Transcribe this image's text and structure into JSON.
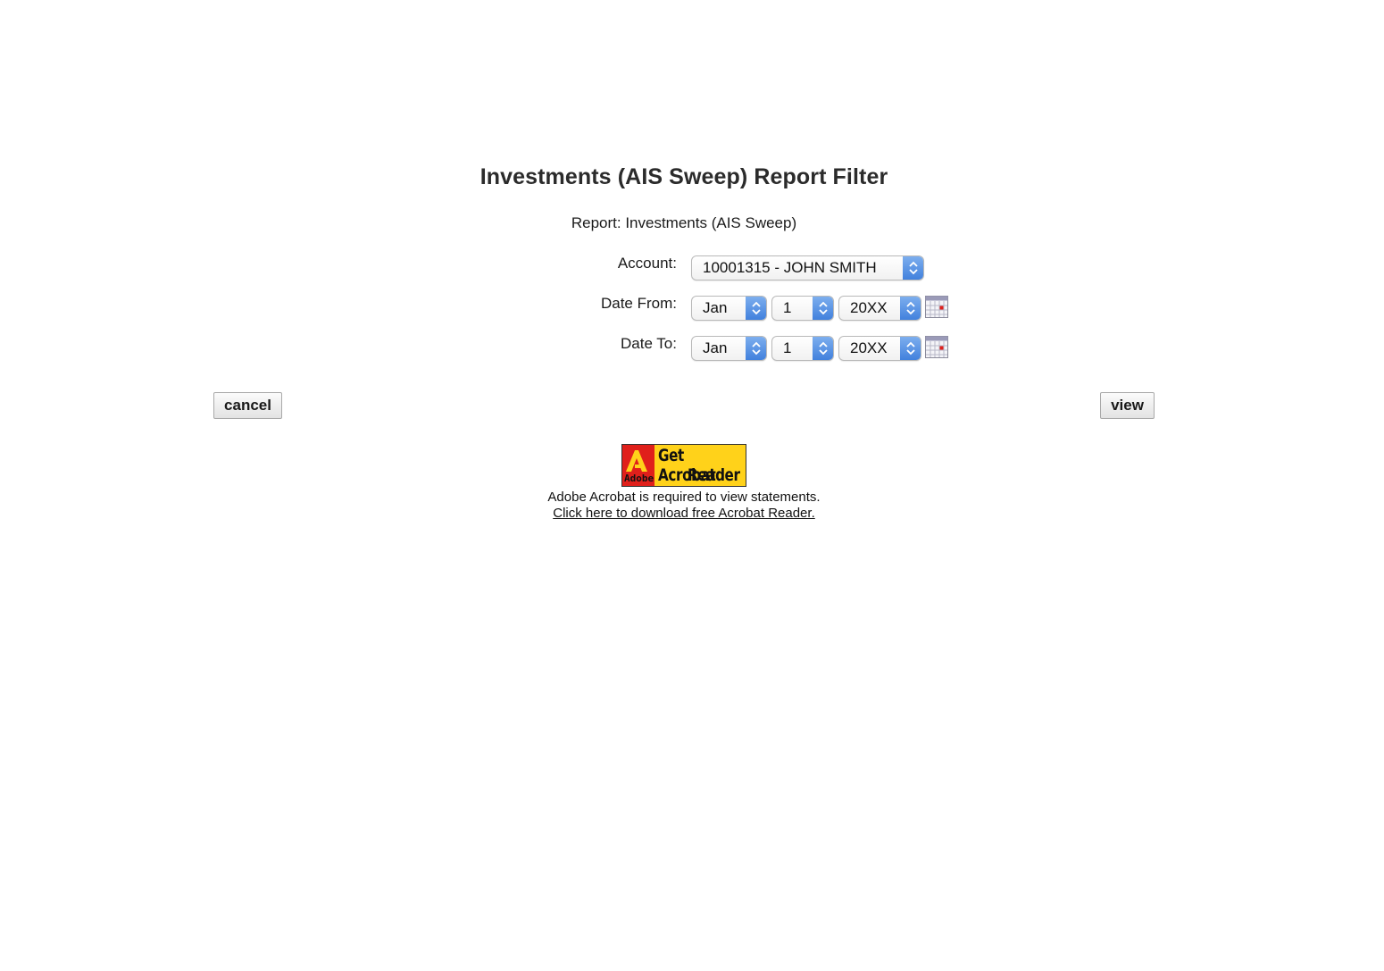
{
  "page": {
    "title": "Investments (AIS Sweep) Report Filter",
    "report_line": "Report: Investments (AIS Sweep)"
  },
  "form": {
    "account": {
      "label": "Account:",
      "value": "10001315 - JOHN SMITH"
    },
    "date_from": {
      "label": "Date From:",
      "month": "Jan",
      "day": "1",
      "year": "20XX"
    },
    "date_to": {
      "label": "Date To:",
      "month": "Jan",
      "day": "1",
      "year": "20XX"
    }
  },
  "buttons": {
    "cancel": "cancel",
    "view": "view"
  },
  "acrobat": {
    "badge_brand": "Adobe",
    "badge_line1": "Get Acrobat",
    "badge_line2": "Reader",
    "note": "Adobe Acrobat is required to view statements.",
    "link": "Click here to download free Acrobat Reader."
  },
  "colors": {
    "select_arrow": "#3f7fdc",
    "badge_yellow": "#ffd21a",
    "adobe_red": "#e0201b"
  }
}
